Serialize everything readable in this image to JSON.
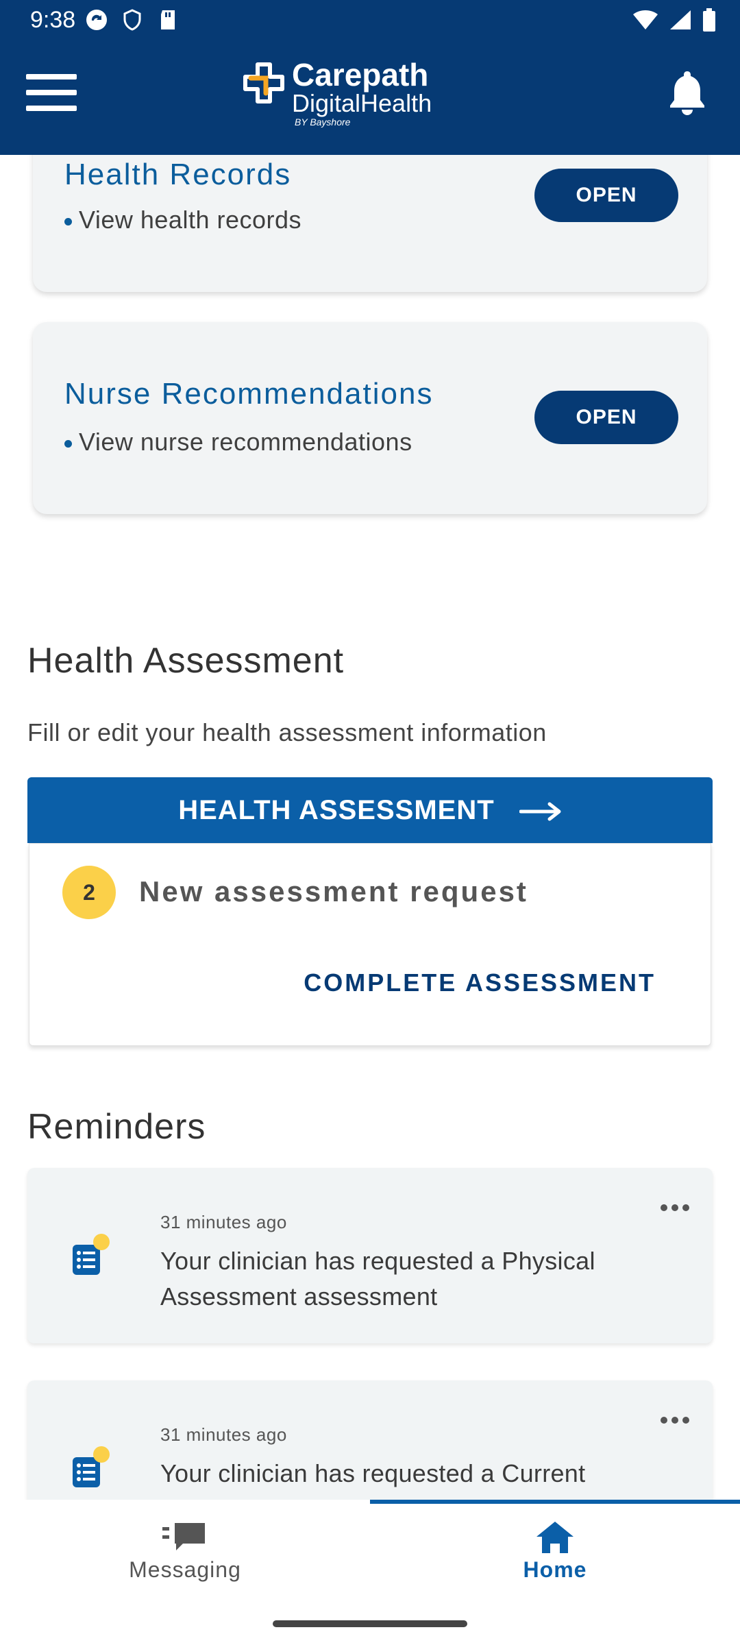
{
  "status_bar": {
    "time": "9:38"
  },
  "header": {
    "brand_line1": "Carepath",
    "brand_line2": "DigitalHealth",
    "brand_line3": "BY Bayshore"
  },
  "cards": [
    {
      "title": "Health Records",
      "bullet": "View health records",
      "button": "OPEN"
    },
    {
      "title": "Nurse Recommendations",
      "bullet": "View nurse recommendations",
      "button": "OPEN"
    }
  ],
  "health_assessment": {
    "title": "Health Assessment",
    "subtitle": "Fill or edit your health assessment information",
    "banner_label": "HEALTH ASSESSMENT",
    "badge_count": "2",
    "request_text": "New assessment request",
    "complete_link": "COMPLETE ASSESSMENT"
  },
  "reminders": {
    "title": "Reminders",
    "items": [
      {
        "time": "31 minutes ago",
        "text": "Your clinician has requested a Physical Assessment assessment"
      },
      {
        "time": "31 minutes ago",
        "text": "Your clinician has requested a Current Medications assessment"
      }
    ]
  },
  "bottom_nav": {
    "items": [
      {
        "label": "Messaging",
        "icon": "chat-icon",
        "active": false
      },
      {
        "label": "Home",
        "icon": "home-icon",
        "active": true
      }
    ]
  },
  "colors": {
    "header_bg": "#063a74",
    "accent_blue": "#0b5fa8",
    "title_blue": "#0b5d9c",
    "badge_yellow": "#fbd049",
    "logo_orange": "#f5a623"
  }
}
